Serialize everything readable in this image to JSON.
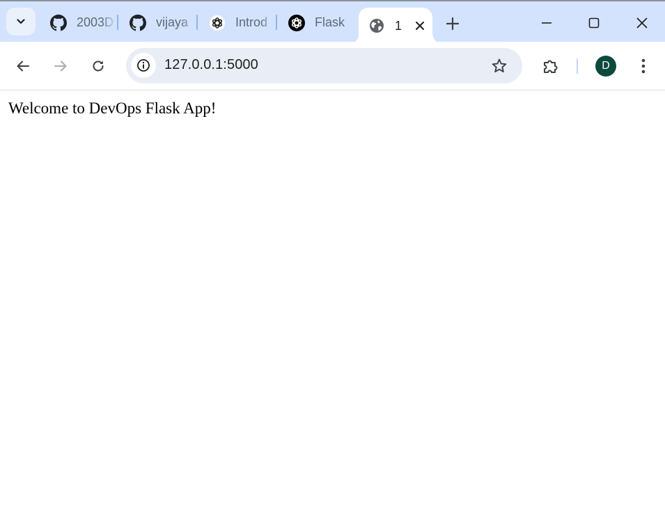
{
  "tabs": [
    {
      "title": "2003D",
      "icon": "github-icon"
    },
    {
      "title": "vijaya",
      "icon": "github-icon"
    },
    {
      "title": "Introd",
      "icon": "chatgpt-icon"
    },
    {
      "title": "Flask",
      "icon": "chatgpt-icon"
    },
    {
      "title": "1",
      "icon": "globe-icon",
      "active": true
    }
  ],
  "address_bar": {
    "url": "127.0.0.1:5000"
  },
  "profile": {
    "initial": "D",
    "color": "#0d4a3c"
  },
  "page": {
    "message": "Welcome to DevOps Flask App!"
  },
  "colors": {
    "tabstrip": "#d3e3fd",
    "omnibox": "#e9eef6",
    "icon": "#3c4043"
  }
}
